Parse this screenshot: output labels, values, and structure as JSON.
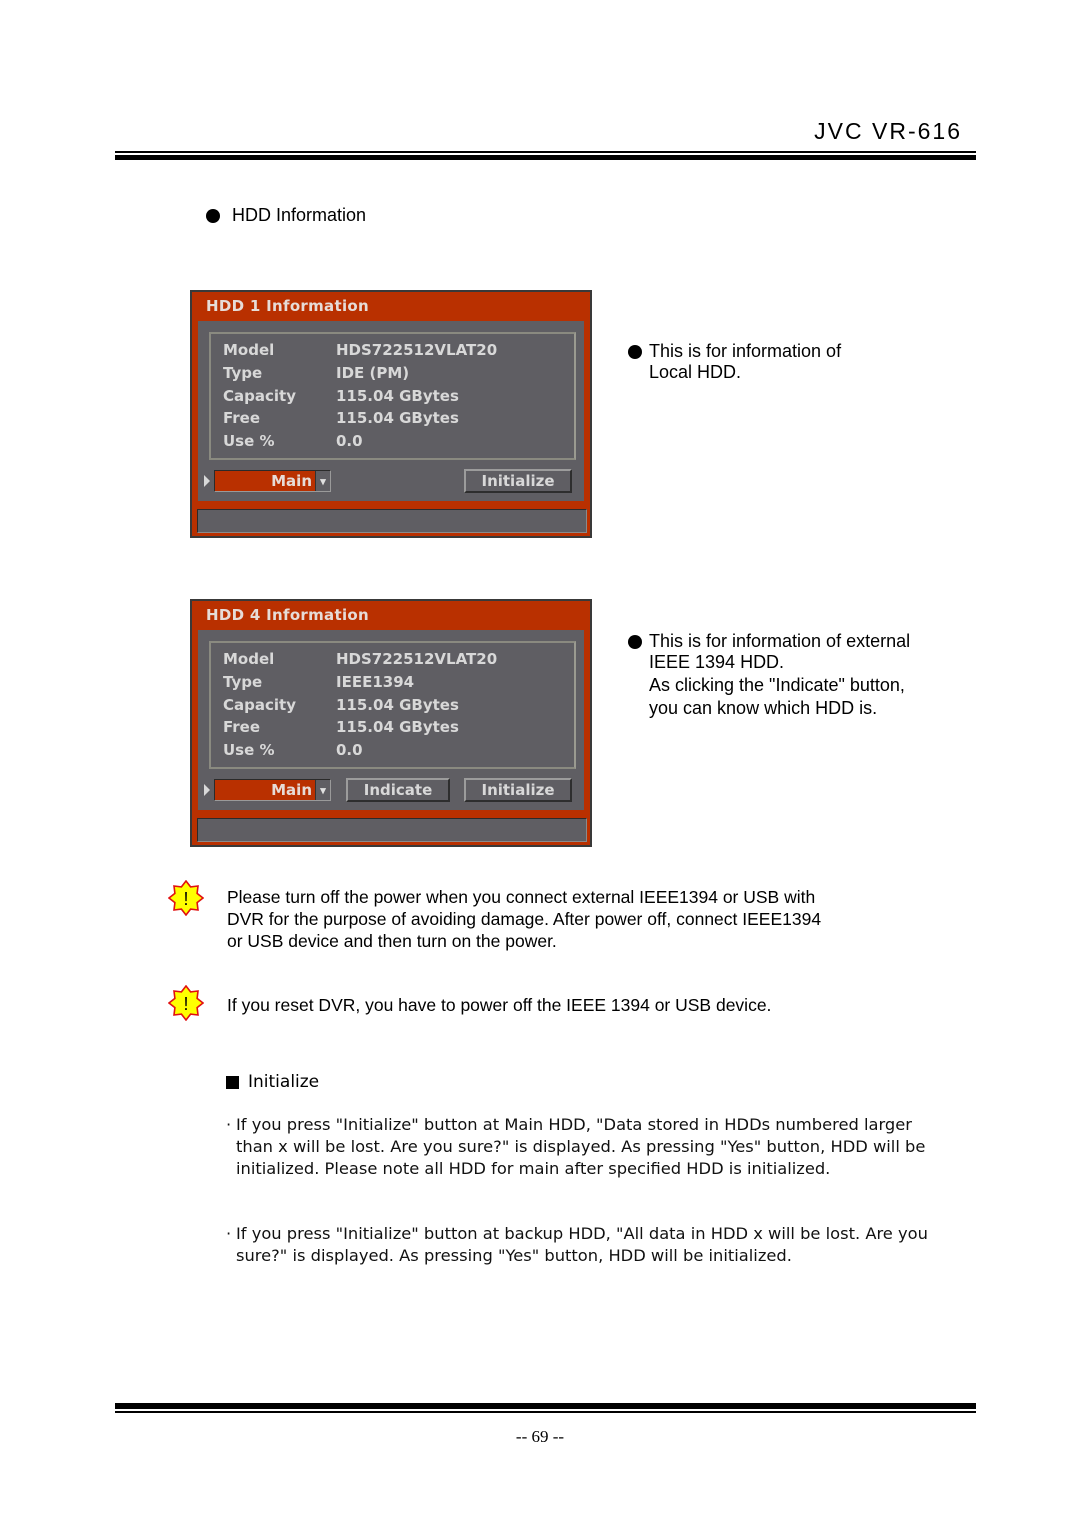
{
  "header": {
    "brand": "JVC VR-616"
  },
  "section": {
    "title": "HDD Information"
  },
  "panels": [
    {
      "title": "HDD 1 Information",
      "fields": [
        {
          "label": "Model",
          "value": "HDS722512VLAT20"
        },
        {
          "label": "Type",
          "value": "IDE (PM)"
        },
        {
          "label": "Capacity",
          "value": "115.04 GBytes"
        },
        {
          "label": "Free",
          "value": "115.04 GBytes"
        },
        {
          "label": "Use %",
          "value": "0.0"
        }
      ],
      "mode_select": "Main",
      "buttons": {
        "initialize": "Initialize"
      },
      "description": [
        "This is for information of",
        "Local HDD."
      ]
    },
    {
      "title": "HDD 4 Information",
      "fields": [
        {
          "label": "Model",
          "value": "HDS722512VLAT20"
        },
        {
          "label": "Type",
          "value": "IEEE1394"
        },
        {
          "label": "Capacity",
          "value": "115.04 GBytes"
        },
        {
          "label": "Free",
          "value": "115.04 GBytes"
        },
        {
          "label": "Use %",
          "value": "0.0"
        }
      ],
      "mode_select": "Main",
      "buttons": {
        "indicate": "Indicate",
        "initialize": "Initialize"
      },
      "description": [
        "This is for information of external",
        "IEEE 1394 HDD.",
        "As clicking the \"Indicate\" button,",
        "you can know which HDD is."
      ]
    }
  ],
  "warnings": [
    {
      "icon": "caution-icon",
      "lines": [
        "Please turn off the power when you connect external IEEE1394 or USB with",
        "DVR for the purpose of avoiding damage. After power off, connect IEEE1394",
        "or USB device and then turn on the power."
      ]
    },
    {
      "icon": "caution-icon",
      "lines": [
        "If you reset DVR, you have to power off the IEEE 1394 or USB device."
      ]
    }
  ],
  "initialize": {
    "title": "Initialize",
    "bullet": "·",
    "paragraphs": [
      "If you press \"Initialize\" button at Main HDD, \"Data stored in HDDs numbered larger than x will be lost. Are you sure?\" is displayed. As pressing \"Yes\" button, HDD will be initialized. Please note all HDD for main after specified HDD is initialized.",
      "If you press \"Initialize\" button at backup HDD, \"All data in HDD x will be lost. Are you sure?\" is displayed. As pressing \"Yes\" button, HDD will be initialized."
    ]
  },
  "footer": {
    "page": "-- 69 --"
  }
}
